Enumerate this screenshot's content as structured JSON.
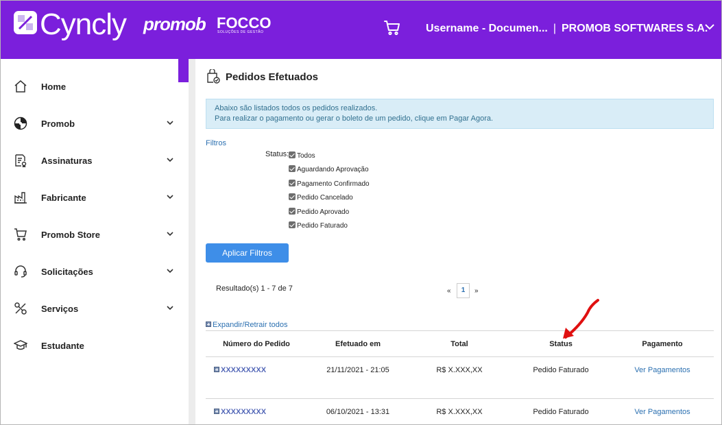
{
  "header": {
    "brand": "Cyncly",
    "partner_logo_1": "promob",
    "partner_logo_2": "FOCCO",
    "partner_logo_2_sub": "SOLUÇÕES DE GESTÃO",
    "username": "Username - Documen...",
    "separator": "|",
    "company": "PROMOB SOFTWARES S.A.",
    "cart_icon": "cart-icon",
    "dropdown_icon": "chevron-down-icon",
    "background_color": "#7b1fdc"
  },
  "sidebar": {
    "items": [
      {
        "label": "Home",
        "icon": "home-icon",
        "has_children": false
      },
      {
        "label": "Promob",
        "icon": "promob-icon",
        "has_children": true
      },
      {
        "label": "Assinaturas",
        "icon": "certificate-icon",
        "has_children": true
      },
      {
        "label": "Fabricante",
        "icon": "factory-icon",
        "has_children": true
      },
      {
        "label": "Promob Store",
        "icon": "cart-icon",
        "has_children": true
      },
      {
        "label": "Solicitações",
        "icon": "headset-icon",
        "has_children": true
      },
      {
        "label": "Serviços",
        "icon": "tools-icon",
        "has_children": true
      },
      {
        "label": "Estudante",
        "icon": "graduation-cap-icon",
        "has_children": false
      }
    ]
  },
  "main": {
    "title": "Pedidos Efetuados",
    "title_icon": "orders-icon",
    "info_line_1": "Abaixo são listados todos os pedidos realizados.",
    "info_line_2": "Para realizar o pagamento ou gerar o boleto de um pedido, clique em Pagar Agora.",
    "filters_label": "Filtros",
    "status_label": "Status:",
    "status_options": [
      {
        "label": "Todos",
        "checked": true
      },
      {
        "label": "Aguardando Aprovação",
        "checked": true
      },
      {
        "label": "Pagamento Confirmado",
        "checked": true
      },
      {
        "label": "Pedido Cancelado",
        "checked": true
      },
      {
        "label": "Pedido Aprovado",
        "checked": true
      },
      {
        "label": "Pedido Faturado",
        "checked": true
      }
    ],
    "apply_button": "Aplicar Filtros",
    "results_text": "Resultado(s) 1 - 7 de 7",
    "pager": {
      "prev": "«",
      "current": "1",
      "next": "»"
    },
    "expand_all": "Expandir/Retrair todos",
    "table": {
      "columns": [
        "Número do Pedido",
        "Efetuado em",
        "Total",
        "Status",
        "Pagamento"
      ],
      "rows": [
        {
          "order": "XXXXXXXXX",
          "date": "21/11/2021 - 21:05",
          "total": "R$ X.XXX,XX",
          "status": "Pedido Faturado",
          "payment": "Ver Pagamentos"
        },
        {
          "order": "XXXXXXXXX",
          "date": "06/10/2021 - 13:31",
          "total": "R$ X.XXX,XX",
          "status": "Pedido Faturado",
          "payment": "Ver Pagamentos"
        }
      ]
    },
    "annotation_arrow_color": "#e01010",
    "link_color": "#2a6fb0",
    "button_color": "#3e8ee8"
  }
}
